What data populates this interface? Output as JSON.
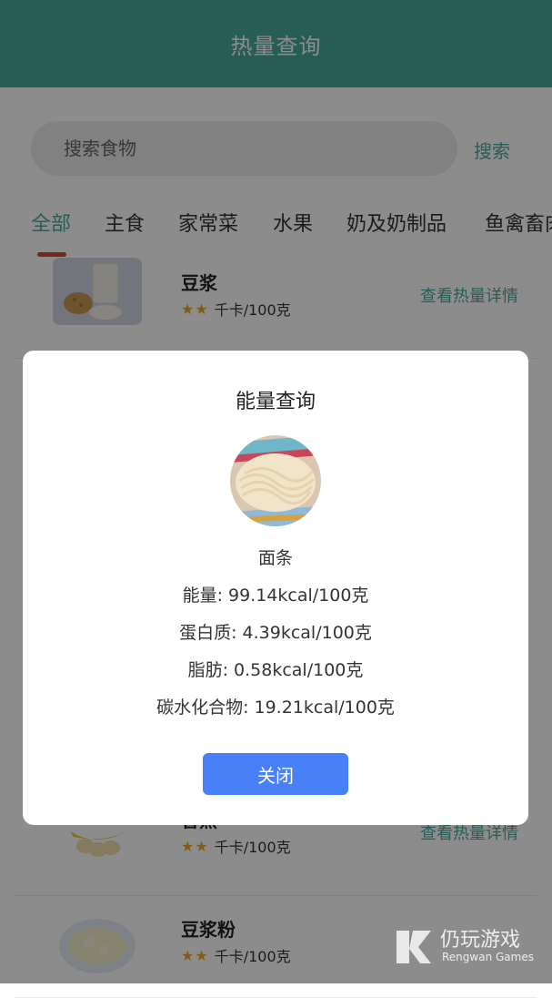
{
  "header": {
    "title": "热量查询"
  },
  "search": {
    "placeholder": "搜索食物",
    "button_label": "搜索"
  },
  "tabs": [
    {
      "label": "全部"
    },
    {
      "label": "主食"
    },
    {
      "label": "家常菜"
    },
    {
      "label": "水果"
    },
    {
      "label": "奶及奶制品"
    },
    {
      "label": "鱼禽畜肉"
    }
  ],
  "list": {
    "items": [
      {
        "name": "豆浆",
        "rating_text": "千卡/100克",
        "stars": 2,
        "detail_label": "查看热量详情"
      },
      {
        "name": "香蕉",
        "rating_text": "千卡/100克",
        "stars": 2,
        "detail_label": "查看热量详情"
      },
      {
        "name": "豆浆粉",
        "rating_text": "千卡/100克",
        "stars": 2
      }
    ]
  },
  "dialog": {
    "title": "能量查询",
    "food_name": "面条",
    "energy": "能量: 99.14kcal/100克",
    "protein": "蛋白质: 4.39kcal/100克",
    "fat": "脂肪: 0.58kcal/100克",
    "carbs": "碳水化合物: 19.21kcal/100克",
    "close_label": "关闭"
  },
  "watermark": {
    "cn": "仍玩游戏",
    "en": "Rengwan Games"
  },
  "colors": {
    "primary": "#4aa99d",
    "button": "#4880f7",
    "star": "#e7a92c",
    "tab_indicator": "#d9483b"
  }
}
